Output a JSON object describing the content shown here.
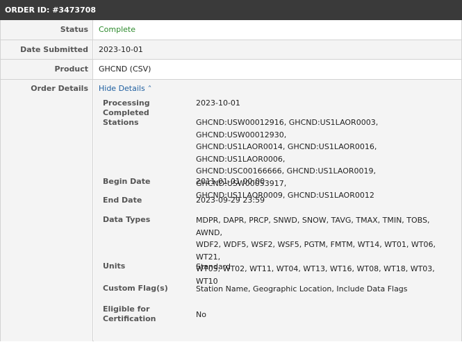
{
  "header": {
    "order_id": "ORDER ID: #3473708"
  },
  "rows": {
    "status": {
      "label": "Status",
      "value": "Complete"
    },
    "date_submitted": {
      "label": "Date Submitted",
      "value": "2023-10-01"
    },
    "product": {
      "label": "Product",
      "value": "GHCND (CSV)"
    },
    "order_details": {
      "label": "Order Details",
      "toggle_label": "Hide Details"
    }
  },
  "details": {
    "processing_completed": {
      "label": "Processing Completed",
      "value": "2023-10-01"
    },
    "stations": {
      "label": "Stations",
      "lines": [
        "GHCND:USW00012916, GHCND:US1LAOR0003, GHCND:USW00012930,",
        "GHCND:US1LAOR0014, GHCND:US1LAOR0016, GHCND:US1LAOR0006,",
        "GHCND:USC00166666, GHCND:US1LAOR0019, GHCND:USW00053917,",
        "GHCND:US1LAOR0009, GHCND:US1LAOR0012"
      ]
    },
    "begin_date": {
      "label": "Begin Date",
      "value": "2011-01-01 00:00"
    },
    "end_date": {
      "label": "End Date",
      "value": "2023-09-29 23:59"
    },
    "data_types": {
      "label": "Data Types",
      "lines": [
        "MDPR, DAPR, PRCP, SNWD, SNOW, TAVG, TMAX, TMIN, TOBS, AWND,",
        "WDF2, WDF5, WSF2, WSF5, PGTM, FMTM, WT14, WT01, WT06, WT21,",
        "WT05, WT02, WT11, WT04, WT13, WT16, WT08, WT18, WT03, WT10"
      ]
    },
    "units": {
      "label": "Units",
      "value": "Standard"
    },
    "custom_flags": {
      "label": "Custom Flag(s)",
      "value": "Station Name, Geographic Location, Include Data Flags"
    },
    "eligible": {
      "label_line1": "Eligible for",
      "label_line2": "Certification",
      "value": "No"
    }
  },
  "colors": {
    "header_bg": "#3a3a3a",
    "status_complete": "#2e8b2e",
    "link": "#1f5fa0",
    "label_bg": "#f4f4f4",
    "border": "#d2d2d2"
  },
  "icons": {
    "toggle": "chevron-up-icon"
  }
}
